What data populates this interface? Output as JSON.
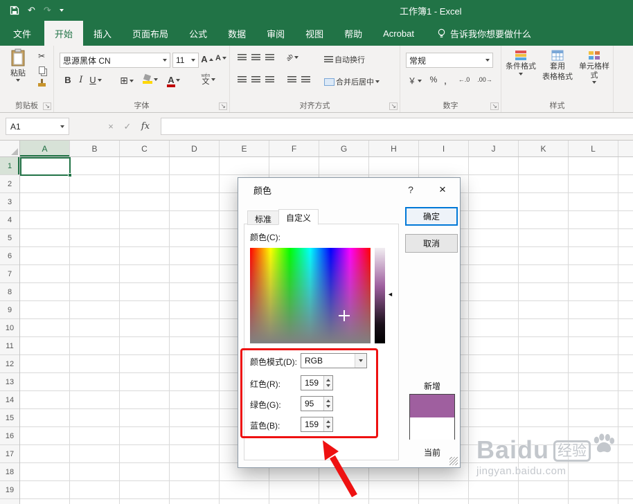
{
  "titlebar": {
    "title": "工作簿1 - Excel"
  },
  "ribbon_tabs": [
    {
      "label": "文件"
    },
    {
      "label": "开始"
    },
    {
      "label": "插入"
    },
    {
      "label": "页面布局"
    },
    {
      "label": "公式"
    },
    {
      "label": "数据"
    },
    {
      "label": "审阅"
    },
    {
      "label": "视图"
    },
    {
      "label": "帮助"
    },
    {
      "label": "Acrobat"
    }
  ],
  "tell_me": "告诉我你想要做什么",
  "ribbon": {
    "clipboard": {
      "paste": "粘贴",
      "label": "剪贴板"
    },
    "font": {
      "name": "思源黑体 CN",
      "size": "11",
      "label": "字体"
    },
    "alignment": {
      "wrap": "自动换行",
      "merge": "合并后居中",
      "label": "对齐方式"
    },
    "number": {
      "format": "常规",
      "label": "数字"
    },
    "styles": {
      "conditional": "条件格式",
      "table1": "套用",
      "table2": "表格格式",
      "cell": "单元格样式",
      "label": "样式"
    }
  },
  "formula_bar": {
    "name_box": "A1",
    "fx": "fx"
  },
  "grid": {
    "columns": [
      "A",
      "B",
      "C",
      "D",
      "E",
      "F",
      "G",
      "H",
      "I",
      "J",
      "K",
      "L"
    ],
    "rows": [
      "1",
      "2",
      "3",
      "4",
      "5",
      "6",
      "7",
      "8",
      "9",
      "10",
      "11",
      "12",
      "13",
      "14",
      "15",
      "16",
      "17",
      "18",
      "19"
    ]
  },
  "dialog": {
    "title": "颜色",
    "help": "?",
    "tab_standard": "标准",
    "tab_custom": "自定义",
    "colors_label": "颜色(C):",
    "mode_label": "颜色模式(D):",
    "mode_value": "RGB",
    "red_label": "红色(R):",
    "red_value": "159",
    "green_label": "绿色(G):",
    "green_value": "95",
    "blue_label": "蓝色(B):",
    "blue_value": "159",
    "ok": "确定",
    "cancel": "取消",
    "new_label": "新增",
    "current_label": "当前",
    "new_color": "#9F5F9F"
  },
  "watermark": {
    "brand": "Baidu",
    "badge": "经验",
    "url": "jingyan.baidu.com"
  },
  "colors": {
    "excel_green": "#217346",
    "annotation_red": "#ee1111"
  },
  "icons": {
    "undo": "↶",
    "redo": "↷",
    "close": "×",
    "check": "✓",
    "cancel_x": "×",
    "cut": "✂",
    "borders": "⊞",
    "bold": "B",
    "italic": "I",
    "underline": "U",
    "font_a": "A",
    "font_color_a": "A",
    "phonetic_top": "wén",
    "phonetic_char": "文",
    "currency": "￥",
    "percent": "%",
    "comma": ",",
    "dec_inc": "←.0",
    "dec_dec": ".00→",
    "launcher": "↘",
    "slider_arrow": "◄"
  }
}
